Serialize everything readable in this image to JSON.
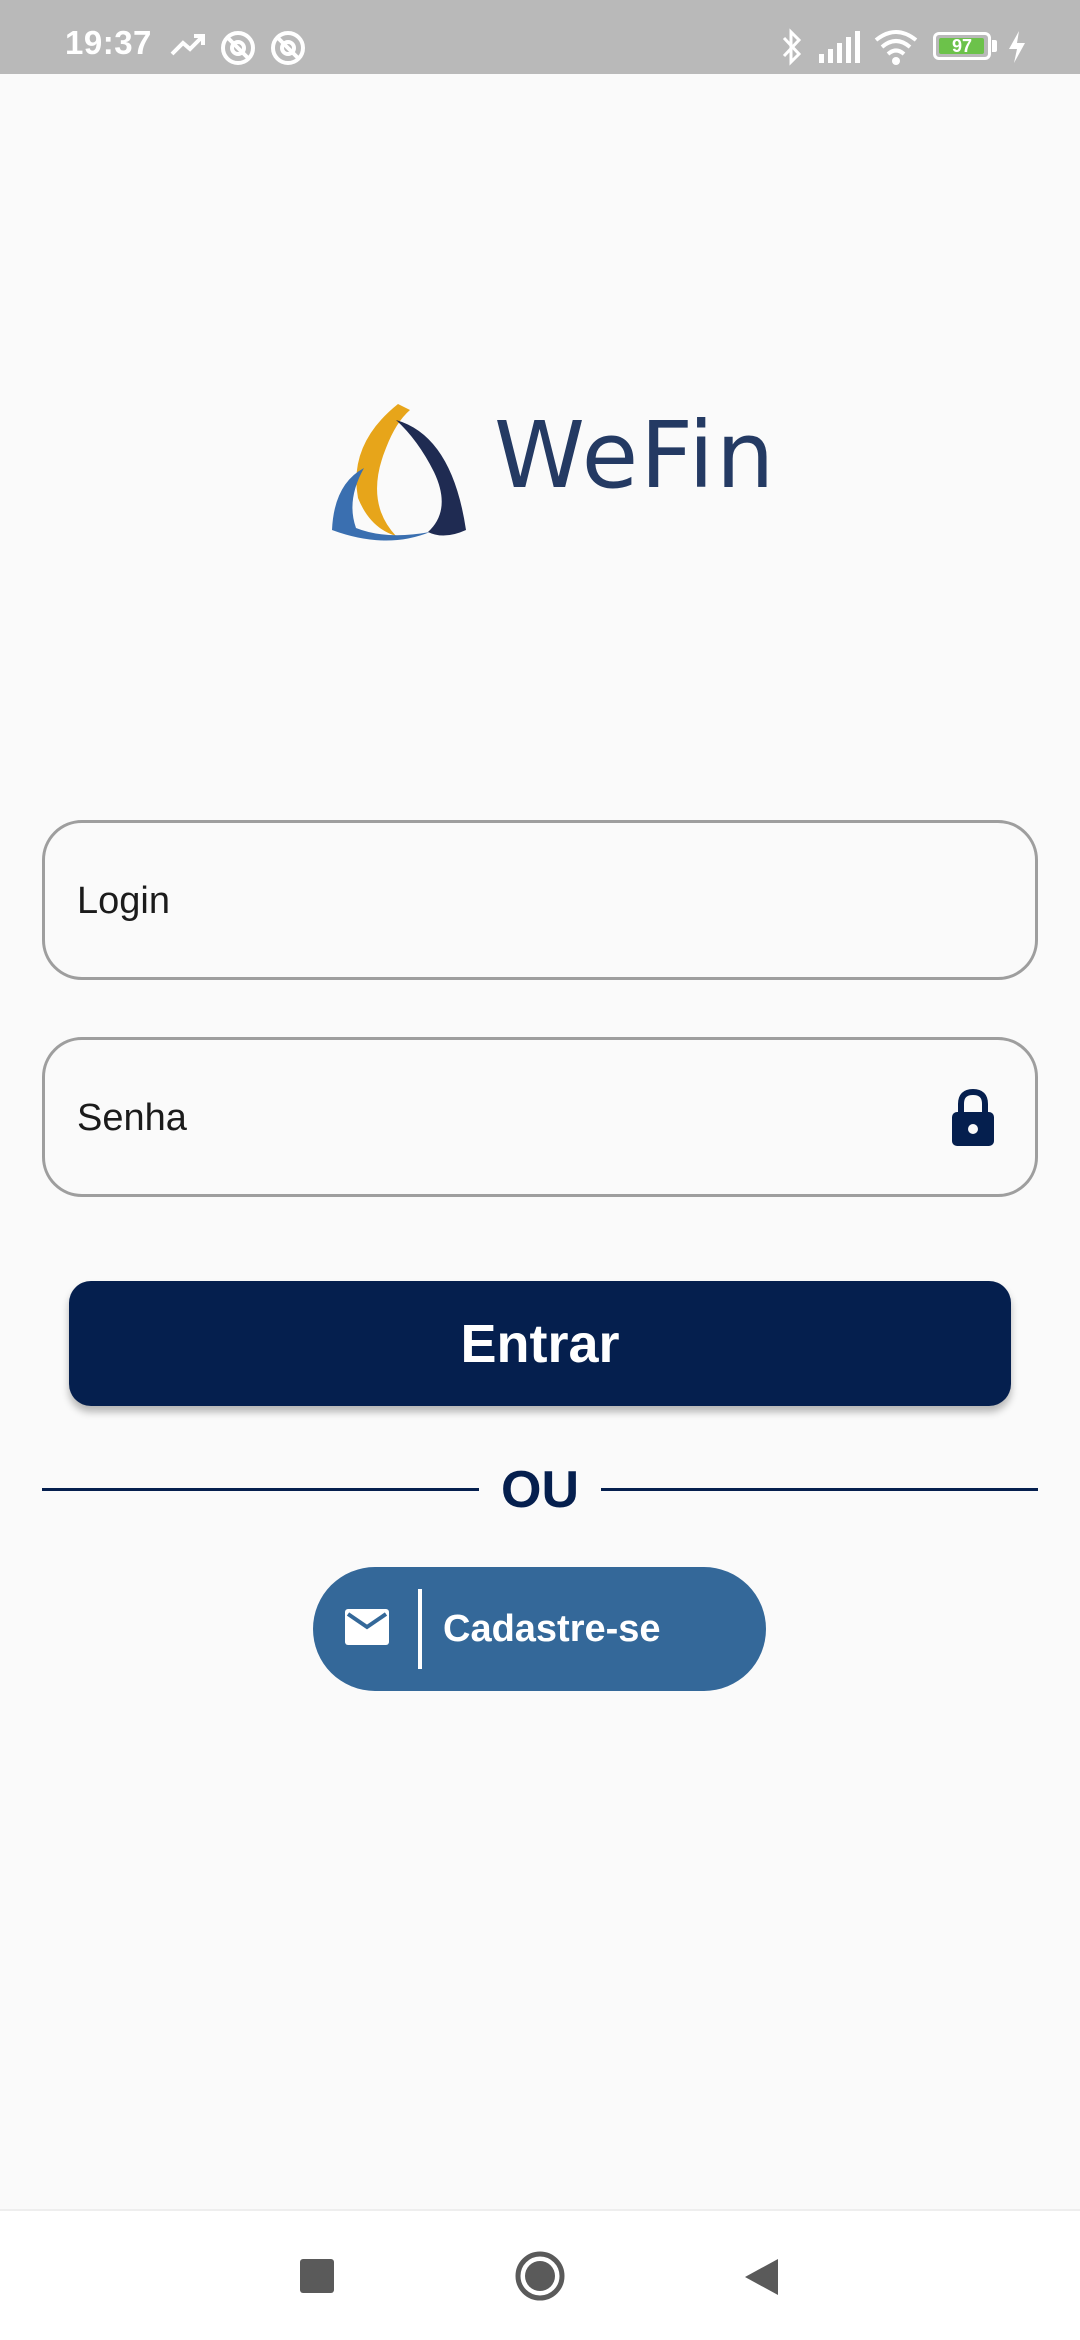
{
  "status_bar": {
    "time": "19:37",
    "battery_level": "97",
    "battery_fraction": 0.97,
    "icons": [
      "trend-icon",
      "at-icon",
      "at-icon",
      "bluetooth-icon",
      "signal-icon",
      "wifi-icon",
      "battery-icon",
      "charging-icon"
    ]
  },
  "logo": {
    "brand_name": "WeFin",
    "colors": {
      "gold": "#e7a51a",
      "blue": "#3a6fb0",
      "navy": "#1f2b52"
    }
  },
  "form": {
    "login_placeholder": "Login",
    "password_placeholder": "Senha",
    "password_icon": "lock-icon"
  },
  "actions": {
    "enter_label": "Entrar",
    "or_label": "OU",
    "signup_label": "Cadastre-se",
    "signup_icon": "mail-icon"
  },
  "nav_bar": {
    "buttons": [
      "recent-apps-button",
      "home-button",
      "back-button"
    ]
  },
  "colors": {
    "primary": "#051f4e",
    "signup": "#346899",
    "background": "#fafafa",
    "border": "#9e9e9e"
  }
}
